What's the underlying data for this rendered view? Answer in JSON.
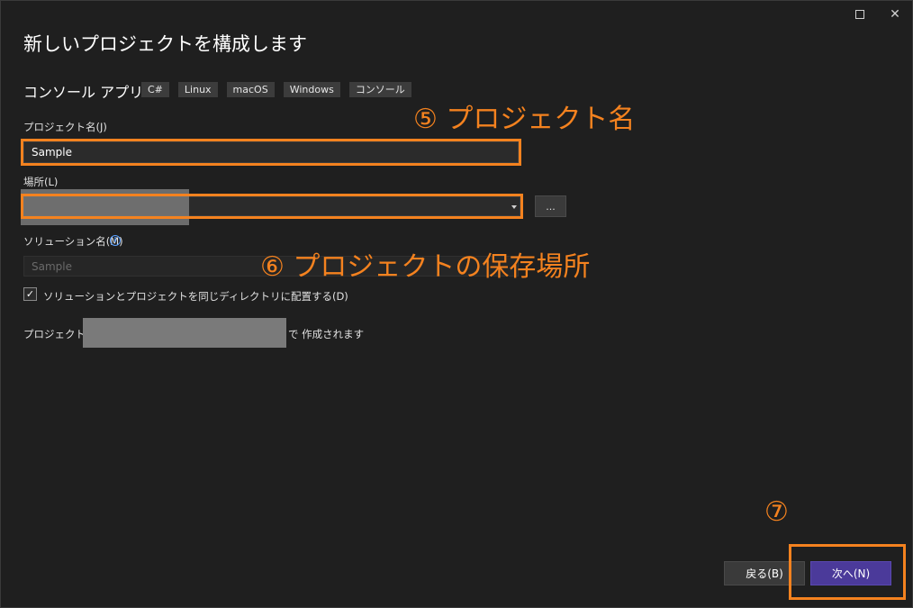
{
  "window": {
    "maximize_icon": "maximize-icon",
    "close_label": "✕"
  },
  "page": {
    "title": "新しいプロジェクトを構成します"
  },
  "template": {
    "name": "コンソール アプリ",
    "tags": [
      "C#",
      "Linux",
      "macOS",
      "Windows",
      "コンソール"
    ]
  },
  "fields": {
    "project_name_label": "プロジェクト名(J)",
    "project_name_value": "Sample",
    "location_label": "場所(L)",
    "location_value": "",
    "browse_label": "...",
    "solution_name_label": "ソリューション名(M)",
    "solution_name_placeholder": "Sample",
    "same_dir_label": "ソリューションとプロジェクトを同じディレクトリに配置する(D)",
    "same_dir_checked": true,
    "path_prefix": "プロジェクト は",
    "path_suffix": "で 作成されます"
  },
  "annotations": {
    "step5": "⑤ プロジェクト名",
    "step6": "⑥ プロジェクトの保存場所",
    "step7": "⑦",
    "color": "#f4821f"
  },
  "buttons": {
    "back": "戻る(B)",
    "next": "次へ(N)"
  },
  "colors": {
    "background": "#1f1f1f",
    "accent_button": "#4b3a9a",
    "highlight": "#f4821f"
  }
}
